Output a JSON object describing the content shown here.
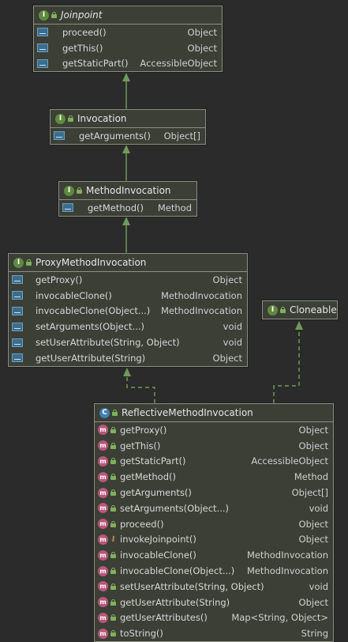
{
  "boxes": {
    "joinpoint": {
      "kind": "I",
      "title": "Joinpoint",
      "methods": [
        {
          "name": "proceed()",
          "type": "Object"
        },
        {
          "name": "getThis()",
          "type": "Object"
        },
        {
          "name": "getStaticPart()",
          "type": "AccessibleObject"
        }
      ]
    },
    "invocation": {
      "kind": "I",
      "title": "Invocation",
      "methods": [
        {
          "name": "getArguments()",
          "type": "Object[]"
        }
      ]
    },
    "methodinvocation": {
      "kind": "I",
      "title": "MethodInvocation",
      "methods": [
        {
          "name": "getMethod()",
          "type": "Method"
        }
      ]
    },
    "proxymethodinvocation": {
      "kind": "I",
      "title": "ProxyMethodInvocation",
      "methods": [
        {
          "name": "getProxy()",
          "type": "Object"
        },
        {
          "name": "invocableClone()",
          "type": "MethodInvocation"
        },
        {
          "name": "invocableClone(Object...)",
          "type": "MethodInvocation"
        },
        {
          "name": "setArguments(Object...)",
          "type": "void"
        },
        {
          "name": "setUserAttribute(String, Object)",
          "type": "void"
        },
        {
          "name": "getUserAttribute(String)",
          "type": "Object"
        }
      ]
    },
    "cloneable": {
      "kind": "I",
      "title": "Cloneable",
      "methods": []
    },
    "reflectivemethodinvocation": {
      "kind": "C",
      "title": "ReflectiveMethodInvocation",
      "methods": [
        {
          "name": "getProxy()",
          "type": "Object",
          "override": true
        },
        {
          "name": "getThis()",
          "type": "Object",
          "override": true
        },
        {
          "name": "getStaticPart()",
          "type": "AccessibleObject",
          "override": true
        },
        {
          "name": "getMethod()",
          "type": "Method",
          "override": true
        },
        {
          "name": "getArguments()",
          "type": "Object[]",
          "override": true
        },
        {
          "name": "setArguments(Object...)",
          "type": "void"
        },
        {
          "name": "proceed()",
          "type": "Object"
        },
        {
          "name": "invokeJoinpoint()",
          "type": "Object",
          "visibility": "protected"
        },
        {
          "name": "invocableClone()",
          "type": "MethodInvocation"
        },
        {
          "name": "invocableClone(Object...)",
          "type": "MethodInvocation"
        },
        {
          "name": "setUserAttribute(String, Object)",
          "type": "void"
        },
        {
          "name": "getUserAttribute(String)",
          "type": "Object"
        },
        {
          "name": "getUserAttributes()",
          "type": "Map<String, Object>"
        },
        {
          "name": "toString()",
          "type": "String"
        }
      ]
    }
  },
  "edges": [
    {
      "from": "invocation",
      "to": "joinpoint",
      "style": "extends"
    },
    {
      "from": "methodinvocation",
      "to": "invocation",
      "style": "extends"
    },
    {
      "from": "proxymethodinvocation",
      "to": "methodinvocation",
      "style": "extends"
    },
    {
      "from": "reflectivemethodinvocation",
      "to": "proxymethodinvocation",
      "style": "implements"
    },
    {
      "from": "reflectivemethodinvocation",
      "to": "cloneable",
      "style": "implements"
    }
  ],
  "colors": {
    "background": "#2b2b2b",
    "box_fill": "#3c3f36",
    "box_border": "#8b8f84",
    "edge": "#6f9a58",
    "interface_badge": "#5f8a3e",
    "class_badge": "#3f7fb3",
    "method_badge": "#b8577a"
  }
}
